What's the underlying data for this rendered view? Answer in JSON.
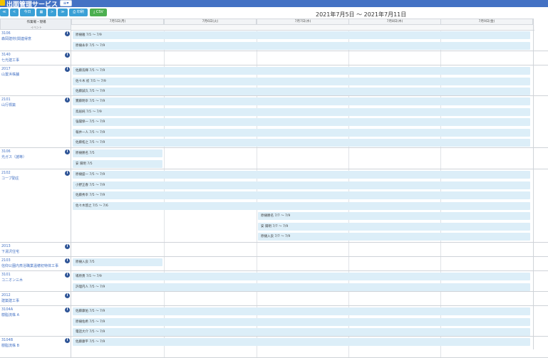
{
  "app": {
    "title": "出面管理サービス",
    "menu_icon": "≡▾"
  },
  "toolbar": {
    "buttons": [
      {
        "label": "≪",
        "name": "first-week-button"
      },
      {
        "label": "<",
        "name": "prev-week-button"
      },
      {
        "label": "今日",
        "name": "today-button"
      },
      {
        "label": "▦",
        "name": "calendar-button"
      },
      {
        "label": ">",
        "name": "next-week-button"
      },
      {
        "label": "≫",
        "name": "last-week-button"
      },
      {
        "label": "⎙ 印刷",
        "name": "print-button"
      },
      {
        "label": "⤓ CSV",
        "name": "csv-button"
      }
    ],
    "range": "2021年7月5日 ～ 2021年7月11日"
  },
  "header": {
    "left_line1": "作業場・現場",
    "left_line2": "イベント",
    "days": [
      "7月5日(月)",
      "7月6日(火)",
      "7月7日(水)",
      "7月8日(木)",
      "7月9日(金)"
    ]
  },
  "groups": [
    {
      "code": "3106",
      "name": "森岡建材(関連得意",
      "bars": [
        {
          "text": "原樋雅 7/5 ～ 7/9",
          "span": "full"
        },
        {
          "text": "原樋永幸 7/5 ～ 7/9",
          "span": "full"
        }
      ]
    },
    {
      "code": "3140",
      "name": "七光建工事",
      "bars": []
    },
    {
      "code": "2017",
      "name": "山置浜株舗",
      "bars": [
        {
          "text": "佐藤浩輝 7/5 ～ 7/9",
          "span": "full"
        },
        {
          "text": "佐々木 初 7/5 ～ 7/9",
          "span": "full"
        },
        {
          "text": "佐藤誠久 7/5 ～ 7/9",
          "span": "full"
        }
      ]
    },
    {
      "code": "2101",
      "name": "山行標築",
      "bars": [
        {
          "text": "實藤明幸 7/5 ～ 7/9",
          "span": "full"
        },
        {
          "text": "鳥居純 7/5 ～ 7/9",
          "span": "full"
        },
        {
          "text": "強閣保一 7/5 ～ 7/9",
          "span": "full"
        },
        {
          "text": "報井一人 7/5 ～ 7/9",
          "span": "full"
        },
        {
          "text": "佐藤拓之 7/5 ～ 7/9",
          "span": "full"
        }
      ]
    },
    {
      "code": "3106",
      "name": "光ガス（諸等）",
      "bars": [
        {
          "text": "原樋勝名 7/5",
          "span": "day1"
        },
        {
          "text": "安 陽明 7/5",
          "span": "day1"
        }
      ]
    },
    {
      "code": "2102",
      "name": "コープ勤庄",
      "bars": [
        {
          "text": "原樋盛一 7/5 ～ 7/9",
          "span": "full"
        },
        {
          "text": "小野正春 7/5 ～ 7/9",
          "span": "full"
        },
        {
          "text": "佐藤秀幸 7/5 ～ 7/9",
          "span": "full"
        },
        {
          "text": "佐々木悠之 7/5 ～ 7/6",
          "span": "full"
        },
        {
          "text": "原樋勝名 7/7 ～ 7/9",
          "span": "late"
        },
        {
          "text": "安 陽明 7/7 ～ 7/9",
          "span": "late"
        },
        {
          "text": "原樋入良 7/7 ～ 7/9",
          "span": "late"
        }
      ]
    },
    {
      "code": "2013",
      "name": "下湯沢住宅",
      "bars": []
    },
    {
      "code": "2103",
      "name": "信仰公園内斎浴職業温穂初特体工事",
      "bars": [
        {
          "text": "原樋入良 7/5",
          "span": "day1"
        }
      ]
    },
    {
      "code": "3101",
      "name": "コニオン三木",
      "bars": [
        {
          "text": "場原勇 7/5 ～ 7/9",
          "span": "full"
        },
        {
          "text": "許理内人 7/5 ～ 7/9",
          "span": "full"
        }
      ]
    },
    {
      "code": "2012",
      "name": "建築建工事",
      "bars": []
    },
    {
      "code": "3104A",
      "name": "樹脂流株 A",
      "bars": [
        {
          "text": "佐藤康佑 7/5 ～ 7/9",
          "span": "full"
        },
        {
          "text": "原樋佑希 7/5 ～ 7/9",
          "span": "full"
        },
        {
          "text": "電話大介 7/5 ～ 7/9",
          "span": "full"
        }
      ]
    },
    {
      "code": "3104B",
      "name": "樹脂流株 B",
      "bars": [
        {
          "text": "佐藤康平 7/5 ～ 7/9",
          "span": "full"
        }
      ]
    }
  ]
}
